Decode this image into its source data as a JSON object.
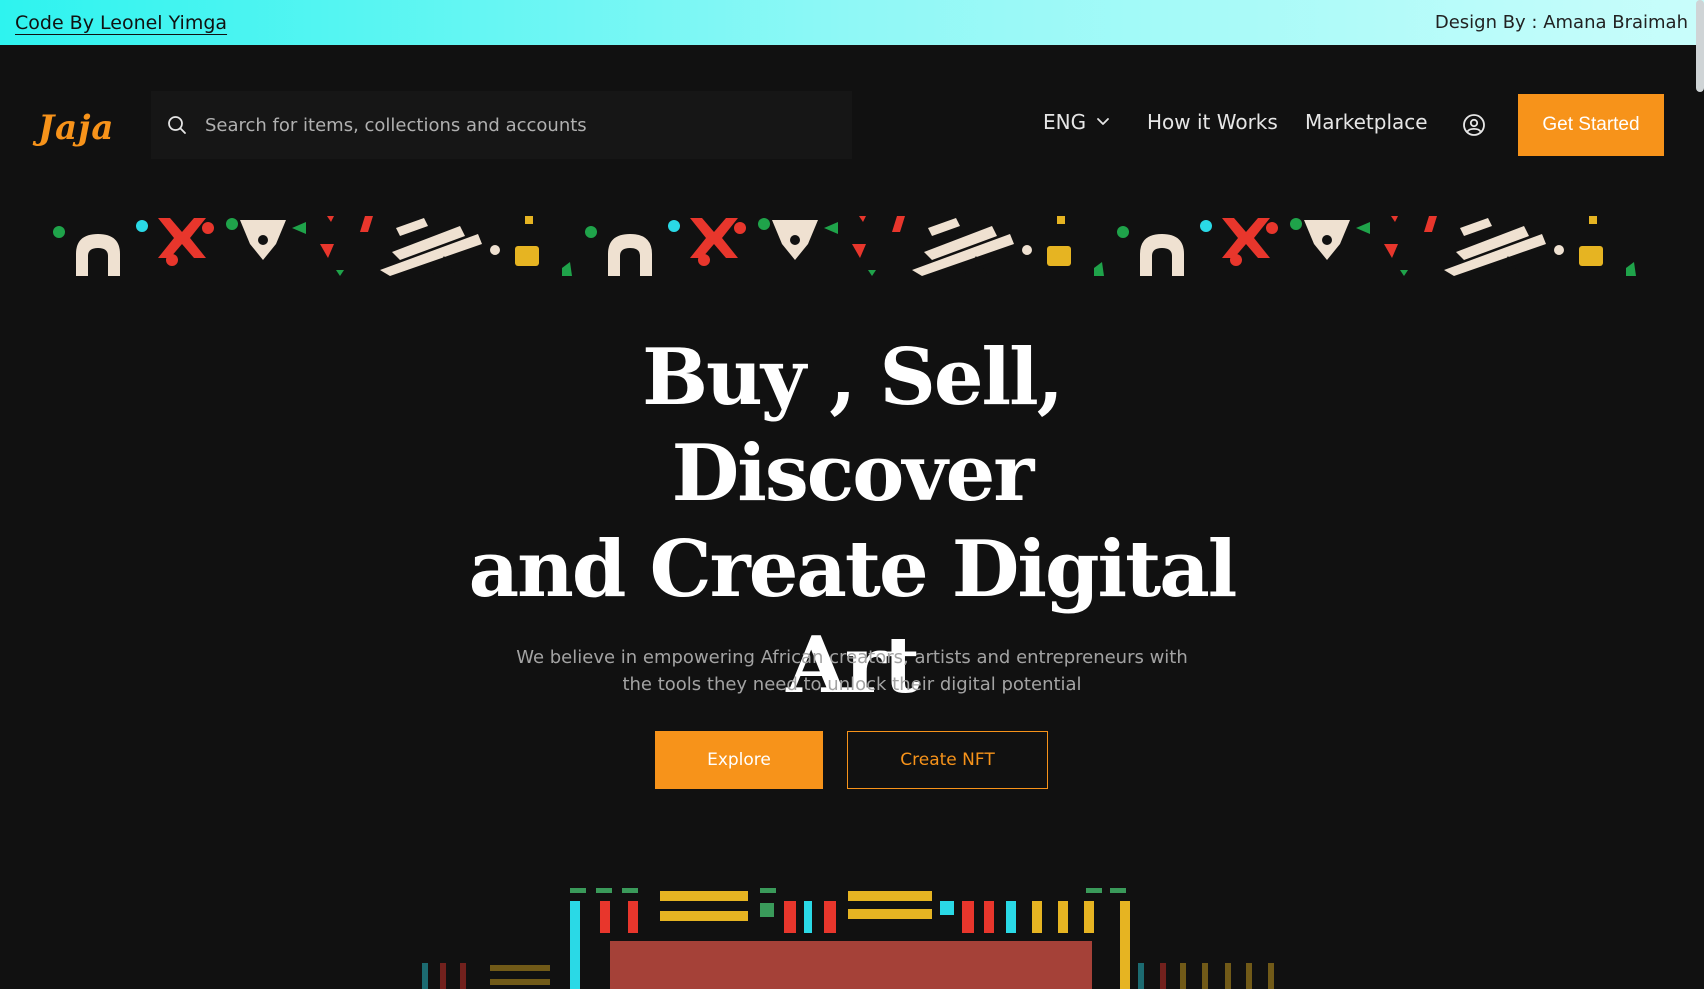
{
  "credits": {
    "code_by": "Code By Leonel Yimga",
    "design_by": "Design By : Amana Braimah"
  },
  "nav": {
    "logo": "Jaja",
    "search_placeholder": "Search for items, collections and accounts",
    "language": "ENG",
    "how_it_works": "How it Works",
    "marketplace": "Marketplace",
    "cta": "Get Started"
  },
  "hero": {
    "title_line1": "Buy , Sell, Discover",
    "title_line2": "and Create Digital",
    "title_line3": "Art",
    "subtitle_line1": "We believe in empowering African creators, artists and entrepreneurs with",
    "subtitle_line2": "the tools they need to unlock their digital potential",
    "explore_label": "Explore",
    "create_label": "Create NFT"
  },
  "colors": {
    "accent": "#f7931a",
    "background": "#111111",
    "credit_bar": "#2ef3ef"
  },
  "icons": [
    "search-icon",
    "chevron-down-icon",
    "user-circle-icon"
  ]
}
